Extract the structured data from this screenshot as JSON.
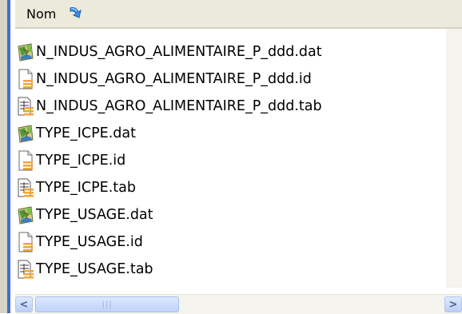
{
  "header": {
    "column_label": "Nom"
  },
  "files": [
    {
      "name": "N_INDUS_AGRO_ALIMENTAIRE_P_ddd.dat",
      "icon": "map-data-file-icon"
    },
    {
      "name": "N_INDUS_AGRO_ALIMENTAIRE_P_ddd.id",
      "icon": "generic-file-icon"
    },
    {
      "name": "N_INDUS_AGRO_ALIMENTAIRE_P_ddd.tab",
      "icon": "table-file-icon"
    },
    {
      "name": "TYPE_ICPE.dat",
      "icon": "map-data-file-icon"
    },
    {
      "name": "TYPE_ICPE.id",
      "icon": "generic-file-icon"
    },
    {
      "name": "TYPE_ICPE.tab",
      "icon": "table-file-icon"
    },
    {
      "name": "TYPE_USAGE.dat",
      "icon": "map-data-file-icon"
    },
    {
      "name": "TYPE_USAGE.id",
      "icon": "generic-file-icon"
    },
    {
      "name": "TYPE_USAGE.tab",
      "icon": "table-file-icon"
    }
  ],
  "scrollbar": {
    "left_glyph": "<",
    "right_glyph": ">",
    "grip_glyph": "|||"
  },
  "colors": {
    "header_bg": "#ebeadb",
    "selection_edge": "#3c6fd2",
    "scroll_blue": "#c3d6fb"
  }
}
